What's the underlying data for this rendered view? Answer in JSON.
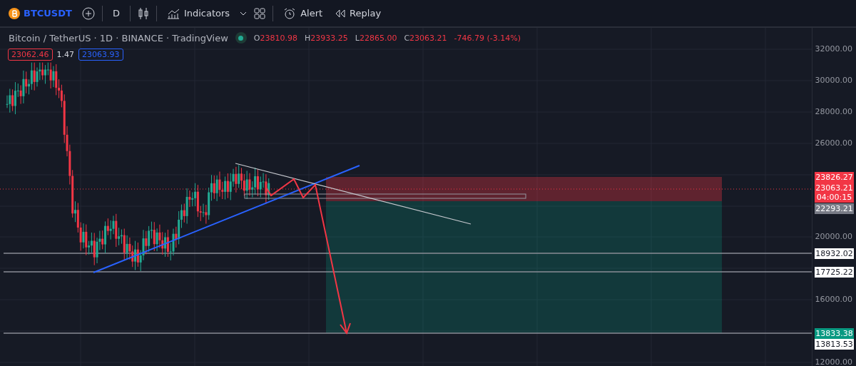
{
  "toolbar": {
    "symbol": "BTCUSDT",
    "interval": "D",
    "indicators": "Indicators",
    "alert": "Alert",
    "replay": "Replay"
  },
  "legend": {
    "title": "Bitcoin / TetherUS · 1D · BINANCE · TradingView",
    "ohlc": [
      {
        "key": "O",
        "value": "23810.98"
      },
      {
        "key": "H",
        "value": "23933.25"
      },
      {
        "key": "L",
        "value": "22865.00"
      },
      {
        "key": "C",
        "value": "23063.21"
      }
    ],
    "change": "-746.79 (-3.14%)",
    "sell": "23062.46",
    "spread": "1.47",
    "buy": "23063.93"
  },
  "price_axis": {
    "ticks": [
      "32000.00",
      "30000.00",
      "28000.00",
      "26000.00",
      "20000.00",
      "16000.00",
      "12000.00"
    ],
    "tags": [
      {
        "kind": "stop",
        "lines": [
          "23826.27"
        ]
      },
      {
        "kind": "last",
        "lines": [
          "23063.21",
          "04:00:15"
        ]
      },
      {
        "kind": "entry",
        "lines": [
          "22293.21"
        ]
      },
      {
        "kind": "level",
        "lines": [
          "18932.02"
        ]
      },
      {
        "kind": "level",
        "lines": [
          "17725.22"
        ]
      },
      {
        "kind": "target",
        "lines": [
          "13833.38"
        ]
      },
      {
        "kind": "level",
        "lines": [
          "13813.53"
        ]
      }
    ]
  }
}
